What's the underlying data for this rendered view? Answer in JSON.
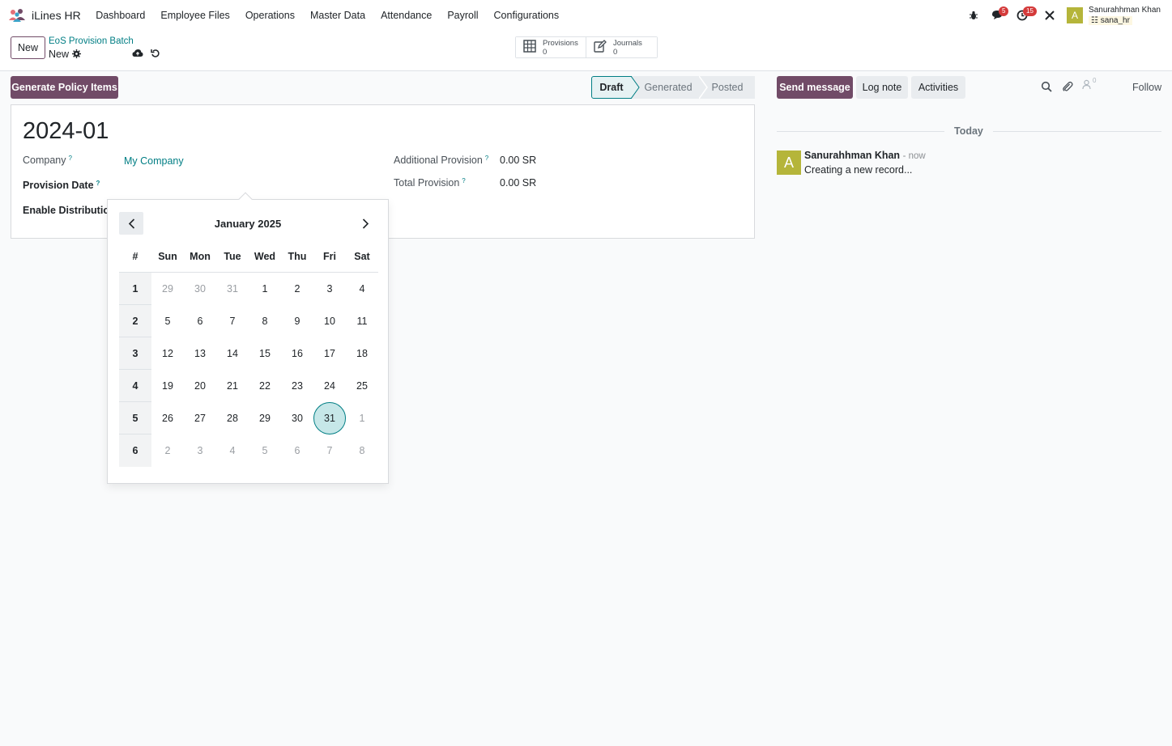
{
  "navbar": {
    "app_name": "iLines HR",
    "menu": [
      "Dashboard",
      "Employee Files",
      "Operations",
      "Master Data",
      "Attendance",
      "Payroll",
      "Configurations"
    ],
    "messages_count": "5",
    "activities_count": "15",
    "user_initial": "A",
    "user_name": "Sanurahhman Khan",
    "user_db": "sana_hr"
  },
  "control": {
    "new_label": "New",
    "breadcrumb": "EoS Provision Batch",
    "record_name": "New",
    "smart_buttons": [
      {
        "label": "Provisions",
        "count": "0"
      },
      {
        "label": "Journals",
        "count": "0"
      }
    ]
  },
  "actions": {
    "generate_label": "Generate Policy Items"
  },
  "status": {
    "stages": [
      "Draft",
      "Generated",
      "Posted"
    ],
    "active": "Draft"
  },
  "form": {
    "title": "2024-01",
    "company_label": "Company",
    "company_value": "My Company",
    "provision_date_label": "Provision Date",
    "enable_distribution_label": "Enable Distribution",
    "additional_provision_label": "Additional Provision",
    "additional_provision_value": "0.00 SR",
    "total_provision_label": "Total Provision",
    "total_provision_value": "0.00 SR",
    "help_mark": "?"
  },
  "chatter": {
    "send_message": "Send message",
    "log_note": "Log note",
    "activities": "Activities",
    "followers_count": "0",
    "follow": "Follow",
    "date_separator": "Today",
    "message": {
      "avatar_initial": "A",
      "author": "Sanurahhman Khan",
      "time": "- now",
      "body": "Creating a new record..."
    }
  },
  "datepicker": {
    "month_title": "January 2025",
    "headers": [
      "#",
      "Sun",
      "Mon",
      "Tue",
      "Wed",
      "Thu",
      "Fri",
      "Sat"
    ],
    "selected_day": "31",
    "weeks": [
      {
        "week": "1",
        "days": [
          {
            "d": "29",
            "m": true
          },
          {
            "d": "30",
            "m": true
          },
          {
            "d": "31",
            "m": true
          },
          {
            "d": "1"
          },
          {
            "d": "2"
          },
          {
            "d": "3"
          },
          {
            "d": "4"
          }
        ]
      },
      {
        "week": "2",
        "days": [
          {
            "d": "5"
          },
          {
            "d": "6"
          },
          {
            "d": "7"
          },
          {
            "d": "8"
          },
          {
            "d": "9"
          },
          {
            "d": "10"
          },
          {
            "d": "11"
          }
        ]
      },
      {
        "week": "3",
        "days": [
          {
            "d": "12"
          },
          {
            "d": "13"
          },
          {
            "d": "14"
          },
          {
            "d": "15"
          },
          {
            "d": "16"
          },
          {
            "d": "17"
          },
          {
            "d": "18"
          }
        ]
      },
      {
        "week": "4",
        "days": [
          {
            "d": "19"
          },
          {
            "d": "20"
          },
          {
            "d": "21"
          },
          {
            "d": "22"
          },
          {
            "d": "23"
          },
          {
            "d": "24"
          },
          {
            "d": "25"
          }
        ]
      },
      {
        "week": "5",
        "days": [
          {
            "d": "26"
          },
          {
            "d": "27"
          },
          {
            "d": "28"
          },
          {
            "d": "29"
          },
          {
            "d": "30"
          },
          {
            "d": "31",
            "s": true
          },
          {
            "d": "1",
            "m": true
          }
        ]
      },
      {
        "week": "6",
        "days": [
          {
            "d": "2",
            "m": true
          },
          {
            "d": "3",
            "m": true
          },
          {
            "d": "4",
            "m": true
          },
          {
            "d": "5",
            "m": true
          },
          {
            "d": "6",
            "m": true
          },
          {
            "d": "7",
            "m": true
          },
          {
            "d": "8",
            "m": true
          }
        ]
      }
    ]
  },
  "colors": {
    "primary": "#714b67",
    "accent": "#017e84",
    "badge": "#d43a3a",
    "avatar": "#b5b53a"
  }
}
